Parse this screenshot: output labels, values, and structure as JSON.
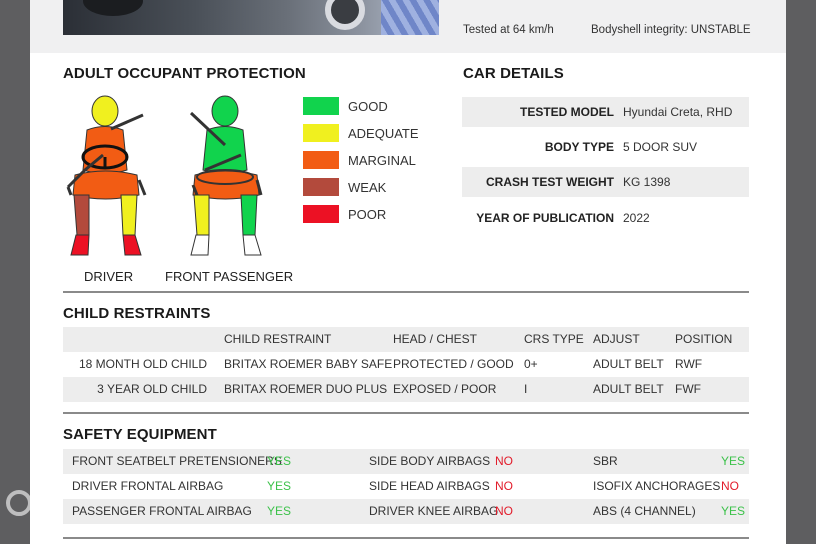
{
  "colors": {
    "good": "#11d34d",
    "adequate": "#f0f01f",
    "marginal": "#f25c14",
    "weak": "#b34a3c",
    "poor": "#ec1124",
    "yes": "#3cc24a",
    "no": "#e21b2a"
  },
  "header": {
    "tested_speed": "Tested at 64 km/h",
    "bodyshell": "Bodyshell integrity: UNSTABLE"
  },
  "adult": {
    "title": "ADULT OCCUPANT PROTECTION",
    "legend": [
      {
        "label": "GOOD",
        "color": "#11d34d"
      },
      {
        "label": "ADEQUATE",
        "color": "#f0f01f"
      },
      {
        "label": "MARGINAL",
        "color": "#f25c14"
      },
      {
        "label": "WEAK",
        "color": "#b34a3c"
      },
      {
        "label": "POOR",
        "color": "#ec1124"
      }
    ],
    "driver_label": "DRIVER",
    "passenger_label": "FRONT PASSENGER",
    "driver_ratings": {
      "head": "adequate",
      "chest": "marginal",
      "pelvis": "marginal",
      "left_leg": "weak",
      "right_leg": "adequate",
      "left_foot": "poor",
      "right_foot": "poor"
    },
    "passenger_ratings": {
      "head": "good",
      "chest": "good",
      "pelvis": "marginal",
      "left_leg": "adequate",
      "right_leg": "good",
      "left_foot": "none",
      "right_foot": "none"
    }
  },
  "car_details": {
    "title": "CAR DETAILS",
    "rows": [
      {
        "key": "TESTED MODEL",
        "value": "Hyundai Creta, RHD"
      },
      {
        "key": "BODY TYPE",
        "value": "5 DOOR SUV"
      },
      {
        "key": "CRASH TEST WEIGHT",
        "value": "KG 1398"
      },
      {
        "key": "YEAR OF PUBLICATION",
        "value": "2022"
      }
    ]
  },
  "child": {
    "title": "CHILD RESTRAINTS",
    "headers": [
      "CHILD RESTRAINT",
      "HEAD / CHEST",
      "CRS TYPE",
      "ADJUST",
      "POSITION"
    ],
    "rows": [
      {
        "occupant": "18 MONTH OLD CHILD",
        "restraint": "BRITAX ROEMER BABY SAFE",
        "head_chest": "PROTECTED / GOOD",
        "crs_type": "0+",
        "adjust": "ADULT BELT",
        "position": "RWF"
      },
      {
        "occupant": "3 YEAR OLD CHILD",
        "restraint": "BRITAX ROEMER DUO PLUS",
        "head_chest": "EXPOSED / POOR",
        "crs_type": "I",
        "adjust": "ADULT BELT",
        "position": "FWF"
      }
    ]
  },
  "safety": {
    "title": "SAFETY EQUIPMENT",
    "rows": [
      [
        {
          "label": "FRONT SEATBELT PRETENSIONERS",
          "value": "YES"
        },
        {
          "label": "SIDE BODY AIRBAGS",
          "value": "NO"
        },
        {
          "label": "SBR",
          "value": "YES"
        }
      ],
      [
        {
          "label": "DRIVER FRONTAL AIRBAG",
          "value": "YES"
        },
        {
          "label": "SIDE HEAD AIRBAGS",
          "value": "NO"
        },
        {
          "label": "ISOFIX ANCHORAGES",
          "value": "NO"
        }
      ],
      [
        {
          "label": "PASSENGER FRONTAL AIRBAG",
          "value": "YES"
        },
        {
          "label": "DRIVER KNEE AIRBAG",
          "value": "NO"
        },
        {
          "label": "ABS (4 CHANNEL)",
          "value": "YES"
        }
      ]
    ]
  }
}
